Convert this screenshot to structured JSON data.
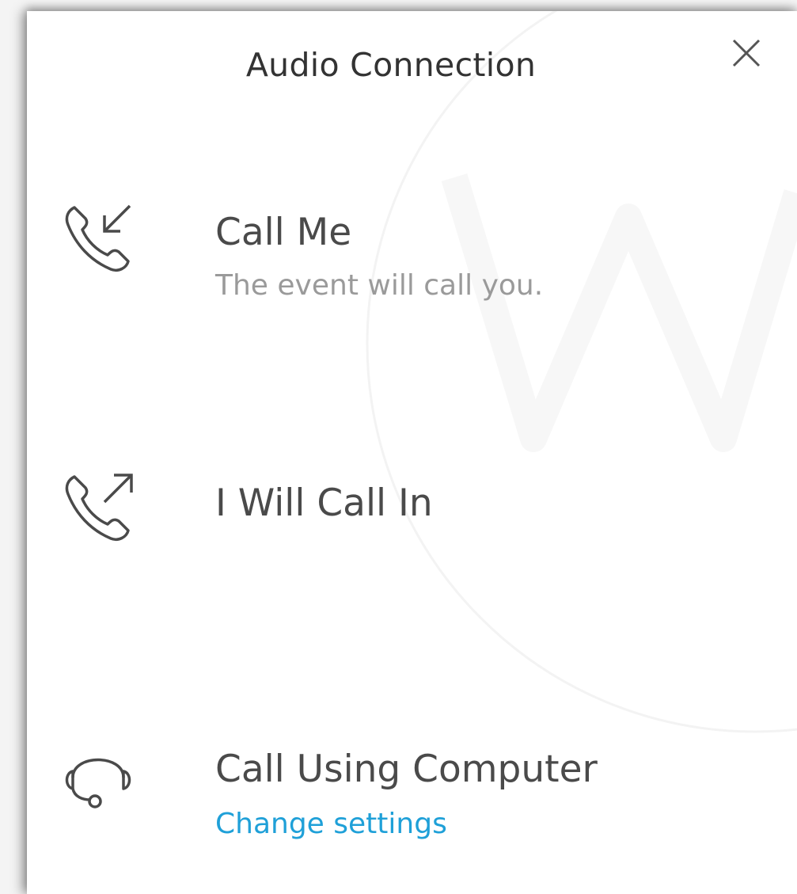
{
  "dialog": {
    "title": "Audio Connection",
    "close_icon": "close-icon"
  },
  "options": {
    "call_me": {
      "icon": "incoming-call-icon",
      "label": "Call Me",
      "description": "The event will call you."
    },
    "call_in": {
      "icon": "outgoing-call-icon",
      "label": "I Will Call In"
    },
    "computer": {
      "icon": "headset-icon",
      "label": "Call Using Computer",
      "link": "Change settings"
    }
  },
  "colors": {
    "text": "#4a4a4a",
    "subtext": "#9a9a9a",
    "link": "#1fa0d8"
  }
}
